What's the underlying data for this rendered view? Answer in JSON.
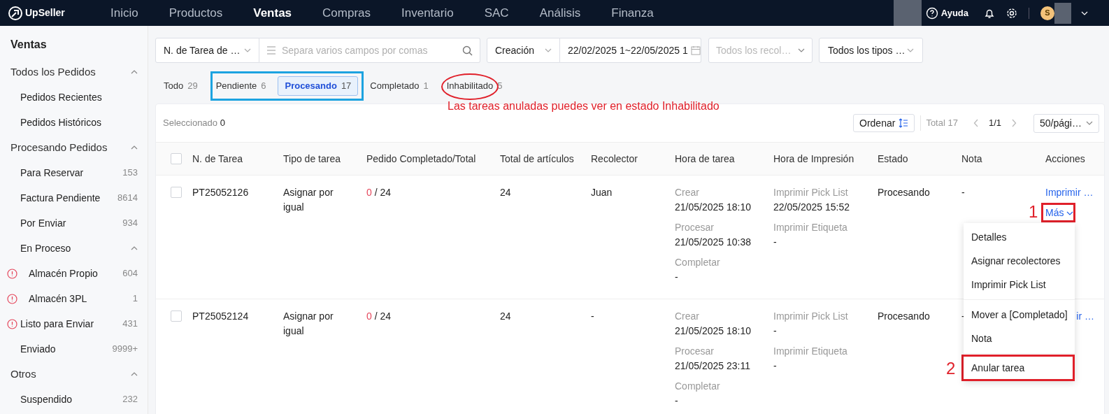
{
  "topbar": {
    "brand": "UpSeller",
    "nav": [
      {
        "label": "Inicio",
        "selected": false
      },
      {
        "label": "Productos",
        "selected": false
      },
      {
        "label": "Ventas",
        "selected": true
      },
      {
        "label": "Compras",
        "selected": false
      },
      {
        "label": "Inventario",
        "selected": false
      },
      {
        "label": "SAC",
        "selected": false
      },
      {
        "label": "Análisis",
        "selected": false
      },
      {
        "label": "Finanza",
        "selected": false
      }
    ],
    "help": "Ayuda",
    "avatar_letter": "S"
  },
  "sidebar": {
    "title": "Ventas",
    "groups": [
      {
        "label": "Todos los Pedidos",
        "expanded": true,
        "children": [
          {
            "label": "Pedidos Recientes"
          },
          {
            "label": "Pedidos Históricos"
          }
        ]
      },
      {
        "label": "Procesando Pedidos",
        "expanded": true,
        "children": [
          {
            "label": "Para Reservar",
            "count": "153"
          },
          {
            "label": "Factura Pendiente",
            "count": "8614"
          },
          {
            "label": "Por Enviar",
            "count": "934"
          },
          {
            "label": "En Proceso",
            "expanded": true,
            "children": [
              {
                "label": "Almacén Propio",
                "count": "604",
                "warning": true
              },
              {
                "label": "Almacén 3PL",
                "count": "1",
                "warning": true
              }
            ]
          },
          {
            "label": "Listo para Enviar",
            "count": "431",
            "warning": true
          },
          {
            "label": "Enviado",
            "count": "9999+"
          }
        ]
      },
      {
        "label": "Otros",
        "expanded": true,
        "children": [
          {
            "label": "Suspendido",
            "count": "232"
          }
        ]
      }
    ]
  },
  "filters": {
    "search_type": "N. de Tarea de …",
    "search_placeholder": "Separa varios campos por comas",
    "date_type": "Creación",
    "date_range": "22/02/2025 1~22/05/2025 1",
    "picker_placeholder": "Todos los recol…",
    "task_type": "Todos los tipos …"
  },
  "tabs": [
    {
      "label": "Todo",
      "count": "29",
      "selected": false
    },
    {
      "label": "Pendiente",
      "count": "6",
      "selected": false
    },
    {
      "label": "Procesando",
      "count": "17",
      "selected": true
    },
    {
      "label": "Completado",
      "count": "1",
      "selected": false
    },
    {
      "label": "Inhabilitado",
      "count": "5",
      "selected": false
    }
  ],
  "annotation_note": "Las tareas anuladas puedes ver en estado Inhabilitado",
  "toolbar": {
    "selected_label": "Seleccionado",
    "selected_count": "0",
    "sort": "Ordenar",
    "total": "Total 17",
    "page": "1/1",
    "page_size": "50/pági…"
  },
  "table": {
    "select_all_checked": false,
    "columns": [
      "N. de Tarea",
      "Tipo de tarea",
      "Pedido Completado/Total",
      "Total de artículos",
      "Recolector",
      "Hora de tarea",
      "Hora de Impresión",
      "Estado",
      "Nota",
      "Acciones"
    ],
    "rows": [
      {
        "checked": false,
        "task": "PT25052126",
        "type": "Asignar por igual",
        "done": "0",
        "total": "/ 24",
        "items": "24",
        "picker": "Juan",
        "times": [
          {
            "label": "Crear",
            "value": "21/05/2025 18:10"
          },
          {
            "label": "Procesar",
            "value": "21/05/2025 10:38"
          },
          {
            "label": "Completar",
            "value": "-"
          }
        ],
        "prints": [
          {
            "label": "Imprimir Pick List",
            "value": "22/05/2025 15:52"
          },
          {
            "label": "Imprimir Etiqueta",
            "value": "-"
          }
        ],
        "status": "Procesando",
        "note": "-",
        "action": "Imprimir …",
        "more": "Más"
      },
      {
        "checked": false,
        "task": "PT25052124",
        "type": "Asignar por igual",
        "done": "0",
        "total": "/ 24",
        "items": "24",
        "picker": "-",
        "times": [
          {
            "label": "Crear",
            "value": "21/05/2025 18:10"
          },
          {
            "label": "Procesar",
            "value": "21/05/2025 23:11"
          },
          {
            "label": "Completar",
            "value": "-"
          }
        ],
        "prints": [
          {
            "label": "Imprimir Pick List",
            "value": "-"
          },
          {
            "label": "Imprimir Etiqueta",
            "value": "-"
          }
        ],
        "status": "Procesando",
        "note": "-",
        "action": "ir …"
      }
    ]
  },
  "menu": {
    "groups": [
      [
        "Detalles",
        "Asignar recolectores",
        "Imprimir Pick List"
      ],
      [
        "Mover a [Completado]",
        "Nota"
      ],
      [
        "Anular tarea"
      ]
    ]
  },
  "markers": [
    "1",
    "2"
  ]
}
